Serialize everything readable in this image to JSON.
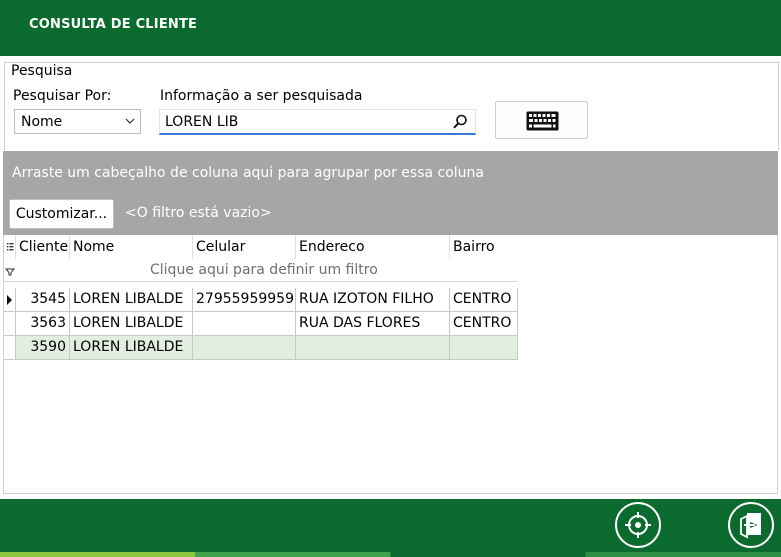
{
  "header": {
    "title": "CONSULTA DE CLIENTE"
  },
  "search": {
    "group_label": "Pesquisa",
    "search_by_label": "Pesquisar Por:",
    "search_by_value": "Nome",
    "info_label": "Informação a ser pesquisada",
    "info_value": "LOREN LIB"
  },
  "group_panel": {
    "hint": "Arraste um cabeçalho de coluna aqui para agrupar por essa coluna",
    "customize_label": "Customizar...",
    "filter_status": "<O filtro está vazio>"
  },
  "grid": {
    "columns": [
      "Cliente",
      "Nome",
      "Celular",
      "Endereco",
      "Bairro"
    ],
    "filter_hint": "Clique aqui para definir um filtro",
    "rows": [
      {
        "cliente": "3545",
        "nome": "LOREN LIBALDE",
        "celular": "27955959959",
        "endereco": "RUA IZOTON FILHO",
        "bairro": "CENTRO"
      },
      {
        "cliente": "3563",
        "nome": "LOREN LIBALDE",
        "celular": "",
        "endereco": "RUA DAS FLORES",
        "bairro": "CENTRO"
      },
      {
        "cliente": "3590",
        "nome": "LOREN LIBALDE",
        "celular": "",
        "endereco": "",
        "bairro": ""
      }
    ]
  },
  "colors": {
    "brand_green": "#0b6a2e",
    "panel_gray": "#a6a6a6",
    "selected_row": "#e2efe0",
    "focus_blue": "#3a7ad6"
  },
  "icons": {
    "search": "search-icon",
    "keyboard": "keyboard-icon",
    "locate": "crosshair-icon",
    "exit": "exit-door-icon"
  }
}
